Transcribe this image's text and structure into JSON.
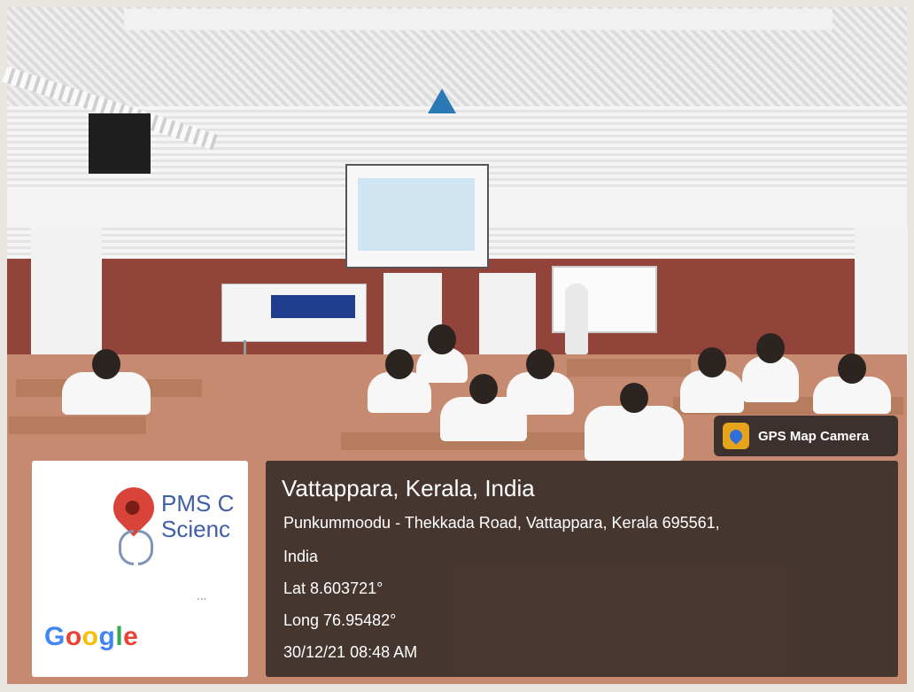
{
  "gps_badge": {
    "label": "GPS Map Camera",
    "icon": "map-pin-icon"
  },
  "map_card": {
    "place_text": "PMS C\nScienc",
    "ellipsis": "...",
    "logo": [
      "G",
      "o",
      "o",
      "g",
      "l",
      "e"
    ],
    "logo_colors": [
      "#4285f4",
      "#ea4335",
      "#fbbc05",
      "#4285f4",
      "#34a853",
      "#ea4335"
    ]
  },
  "location": {
    "title": "Vattappara, Kerala, India",
    "address_line1": "Punkummoodu - Thekkada Road, Vattappara, Kerala 695561,",
    "address_line2": "India",
    "lat": "Lat 8.603721°",
    "long": "Long 76.95482°",
    "datetime": "30/12/21 08:48 AM"
  },
  "colors": {
    "overlay": "#1a181a",
    "pin": "#d9443a",
    "map_text": "#3f5ea8",
    "wall_red": "#93443a"
  }
}
